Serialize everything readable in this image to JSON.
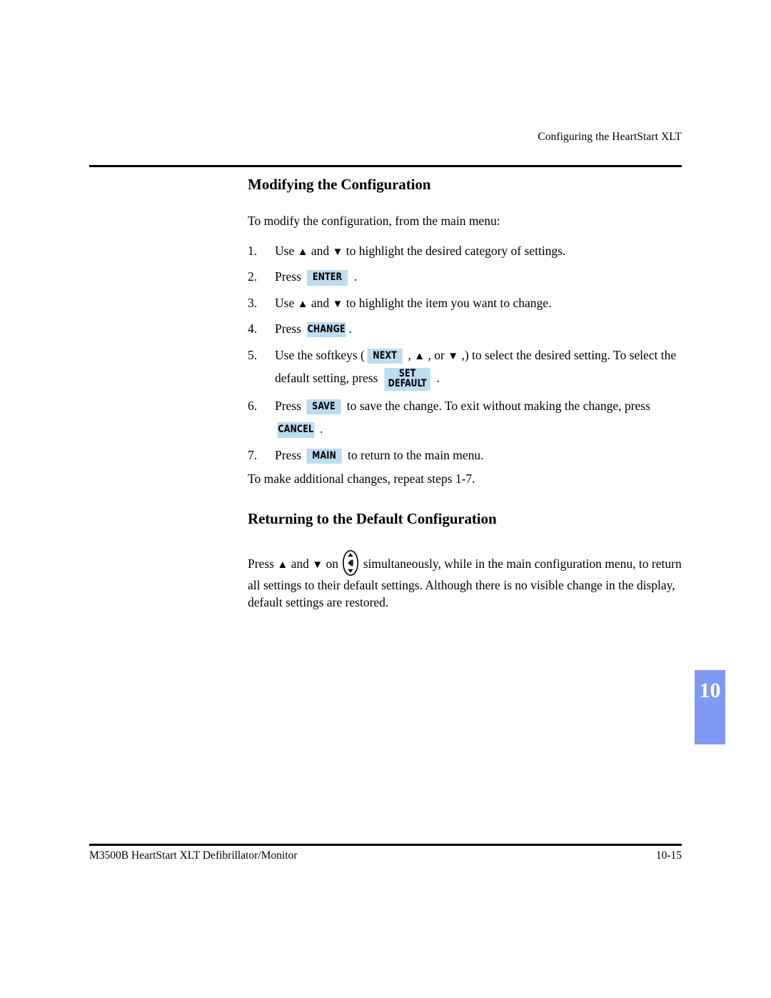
{
  "header": {
    "running_head": "Configuring the HeartStart XLT"
  },
  "section1": {
    "title": "Modifying the Configuration",
    "intro": "To modify the configuration, from the main menu:",
    "steps": [
      {
        "num": "1.",
        "parts": [
          {
            "t": "text",
            "v": "Use "
          },
          {
            "t": "arrow",
            "v": "▲"
          },
          {
            "t": "text",
            "v": " and "
          },
          {
            "t": "arrow",
            "v": "▼"
          },
          {
            "t": "text",
            "v": " to highlight the desired category of settings."
          }
        ]
      },
      {
        "num": "2.",
        "parts": [
          {
            "t": "text",
            "v": "Press "
          },
          {
            "t": "key",
            "v": "ENTER",
            "pad": "wide"
          },
          {
            "t": "text",
            "v": " ."
          }
        ]
      },
      {
        "num": "3.",
        "parts": [
          {
            "t": "text",
            "v": "Use "
          },
          {
            "t": "arrow",
            "v": "▲"
          },
          {
            "t": "text",
            "v": " and "
          },
          {
            "t": "arrow",
            "v": "▼"
          },
          {
            "t": "text",
            "v": " to highlight the item you want to change."
          }
        ]
      },
      {
        "num": "4.",
        "parts": [
          {
            "t": "text",
            "v": "Press "
          },
          {
            "t": "key",
            "v": "CHANGE",
            "pad": "tight"
          },
          {
            "t": "text",
            "v": "."
          }
        ]
      },
      {
        "num": "5.",
        "parts": [
          {
            "t": "text",
            "v": "Use the softkeys ("
          },
          {
            "t": "key",
            "v": "NEXT",
            "pad": "wide"
          },
          {
            "t": "text",
            "v": " , "
          },
          {
            "t": "arrow",
            "v": "▲"
          },
          {
            "t": "text",
            "v": " , or "
          },
          {
            "t": "arrow",
            "v": "▼"
          },
          {
            "t": "text",
            "v": " ,) to select the desired setting. To select the default setting, press "
          },
          {
            "t": "key2",
            "l1": "SET",
            "l2": "DEFAULT"
          },
          {
            "t": "text",
            "v": " ."
          }
        ]
      },
      {
        "num": "6.",
        "parts": [
          {
            "t": "text",
            "v": "Press "
          },
          {
            "t": "key",
            "v": "SAVE",
            "pad": "wide"
          },
          {
            "t": "text",
            "v": " to save the change. To exit without making the change, press "
          },
          {
            "t": "key",
            "v": "CANCEL",
            "pad": "tight"
          },
          {
            "t": "text",
            "v": " ."
          }
        ]
      },
      {
        "num": "7.",
        "parts": [
          {
            "t": "text",
            "v": " Press "
          },
          {
            "t": "key",
            "v": "MAIN",
            "pad": "wide"
          },
          {
            "t": "text",
            "v": " to return to the main menu."
          }
        ]
      }
    ],
    "outro": "To make additional changes, repeat steps 1-7."
  },
  "section2": {
    "title": "Returning to the Default Configuration",
    "paragraph_parts": [
      {
        "t": "text",
        "v": "Press "
      },
      {
        "t": "arrow",
        "v": "▲"
      },
      {
        "t": "text",
        "v": " and "
      },
      {
        "t": "arrow",
        "v": "▼"
      },
      {
        "t": "text",
        "v": " on "
      },
      {
        "t": "navicon",
        "v": "navigation-button-icon"
      },
      {
        "t": "text",
        "v": " simultaneously, while in the main configuration menu, to return all settings to their default settings. Although there is no visible change in the display, default settings are restored."
      }
    ]
  },
  "chapter_tab": {
    "number": "10",
    "color": "#8099f5"
  },
  "footer": {
    "left": "M3500B HeartStart XLT Defibrillator/Monitor",
    "right": "10-15"
  },
  "colors": {
    "softkey_highlight": "#bcdcf0",
    "chapter_tab": "#8099f5",
    "rule": "#000000",
    "text": "#000000"
  }
}
